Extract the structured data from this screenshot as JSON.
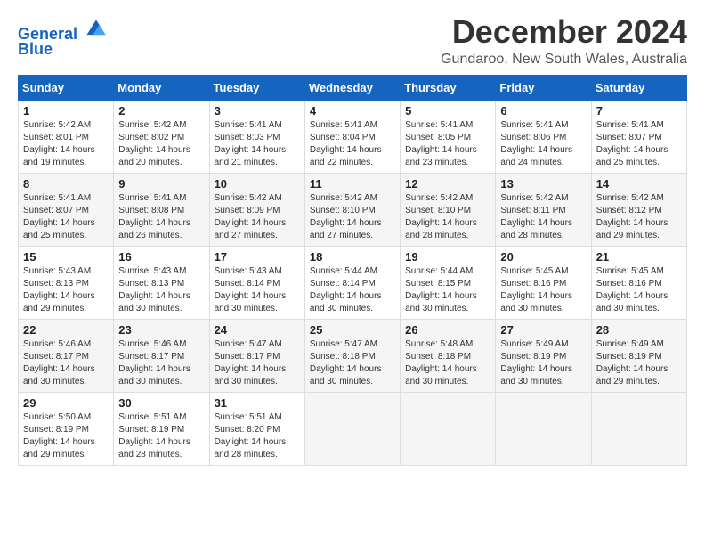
{
  "logo": {
    "text1": "General",
    "text2": "Blue"
  },
  "title": "December 2024",
  "subtitle": "Gundaroo, New South Wales, Australia",
  "days_header": [
    "Sunday",
    "Monday",
    "Tuesday",
    "Wednesday",
    "Thursday",
    "Friday",
    "Saturday"
  ],
  "weeks": [
    [
      {
        "day": "1",
        "info": "Sunrise: 5:42 AM\nSunset: 8:01 PM\nDaylight: 14 hours\nand 19 minutes."
      },
      {
        "day": "2",
        "info": "Sunrise: 5:42 AM\nSunset: 8:02 PM\nDaylight: 14 hours\nand 20 minutes."
      },
      {
        "day": "3",
        "info": "Sunrise: 5:41 AM\nSunset: 8:03 PM\nDaylight: 14 hours\nand 21 minutes."
      },
      {
        "day": "4",
        "info": "Sunrise: 5:41 AM\nSunset: 8:04 PM\nDaylight: 14 hours\nand 22 minutes."
      },
      {
        "day": "5",
        "info": "Sunrise: 5:41 AM\nSunset: 8:05 PM\nDaylight: 14 hours\nand 23 minutes."
      },
      {
        "day": "6",
        "info": "Sunrise: 5:41 AM\nSunset: 8:06 PM\nDaylight: 14 hours\nand 24 minutes."
      },
      {
        "day": "7",
        "info": "Sunrise: 5:41 AM\nSunset: 8:07 PM\nDaylight: 14 hours\nand 25 minutes."
      }
    ],
    [
      {
        "day": "8",
        "info": "Sunrise: 5:41 AM\nSunset: 8:07 PM\nDaylight: 14 hours\nand 25 minutes."
      },
      {
        "day": "9",
        "info": "Sunrise: 5:41 AM\nSunset: 8:08 PM\nDaylight: 14 hours\nand 26 minutes."
      },
      {
        "day": "10",
        "info": "Sunrise: 5:42 AM\nSunset: 8:09 PM\nDaylight: 14 hours\nand 27 minutes."
      },
      {
        "day": "11",
        "info": "Sunrise: 5:42 AM\nSunset: 8:10 PM\nDaylight: 14 hours\nand 27 minutes."
      },
      {
        "day": "12",
        "info": "Sunrise: 5:42 AM\nSunset: 8:10 PM\nDaylight: 14 hours\nand 28 minutes."
      },
      {
        "day": "13",
        "info": "Sunrise: 5:42 AM\nSunset: 8:11 PM\nDaylight: 14 hours\nand 28 minutes."
      },
      {
        "day": "14",
        "info": "Sunrise: 5:42 AM\nSunset: 8:12 PM\nDaylight: 14 hours\nand 29 minutes."
      }
    ],
    [
      {
        "day": "15",
        "info": "Sunrise: 5:43 AM\nSunset: 8:13 PM\nDaylight: 14 hours\nand 29 minutes."
      },
      {
        "day": "16",
        "info": "Sunrise: 5:43 AM\nSunset: 8:13 PM\nDaylight: 14 hours\nand 30 minutes."
      },
      {
        "day": "17",
        "info": "Sunrise: 5:43 AM\nSunset: 8:14 PM\nDaylight: 14 hours\nand 30 minutes."
      },
      {
        "day": "18",
        "info": "Sunrise: 5:44 AM\nSunset: 8:14 PM\nDaylight: 14 hours\nand 30 minutes."
      },
      {
        "day": "19",
        "info": "Sunrise: 5:44 AM\nSunset: 8:15 PM\nDaylight: 14 hours\nand 30 minutes."
      },
      {
        "day": "20",
        "info": "Sunrise: 5:45 AM\nSunset: 8:16 PM\nDaylight: 14 hours\nand 30 minutes."
      },
      {
        "day": "21",
        "info": "Sunrise: 5:45 AM\nSunset: 8:16 PM\nDaylight: 14 hours\nand 30 minutes."
      }
    ],
    [
      {
        "day": "22",
        "info": "Sunrise: 5:46 AM\nSunset: 8:17 PM\nDaylight: 14 hours\nand 30 minutes."
      },
      {
        "day": "23",
        "info": "Sunrise: 5:46 AM\nSunset: 8:17 PM\nDaylight: 14 hours\nand 30 minutes."
      },
      {
        "day": "24",
        "info": "Sunrise: 5:47 AM\nSunset: 8:17 PM\nDaylight: 14 hours\nand 30 minutes."
      },
      {
        "day": "25",
        "info": "Sunrise: 5:47 AM\nSunset: 8:18 PM\nDaylight: 14 hours\nand 30 minutes."
      },
      {
        "day": "26",
        "info": "Sunrise: 5:48 AM\nSunset: 8:18 PM\nDaylight: 14 hours\nand 30 minutes."
      },
      {
        "day": "27",
        "info": "Sunrise: 5:49 AM\nSunset: 8:19 PM\nDaylight: 14 hours\nand 30 minutes."
      },
      {
        "day": "28",
        "info": "Sunrise: 5:49 AM\nSunset: 8:19 PM\nDaylight: 14 hours\nand 29 minutes."
      }
    ],
    [
      {
        "day": "29",
        "info": "Sunrise: 5:50 AM\nSunset: 8:19 PM\nDaylight: 14 hours\nand 29 minutes."
      },
      {
        "day": "30",
        "info": "Sunrise: 5:51 AM\nSunset: 8:19 PM\nDaylight: 14 hours\nand 28 minutes."
      },
      {
        "day": "31",
        "info": "Sunrise: 5:51 AM\nSunset: 8:20 PM\nDaylight: 14 hours\nand 28 minutes."
      },
      null,
      null,
      null,
      null
    ]
  ]
}
